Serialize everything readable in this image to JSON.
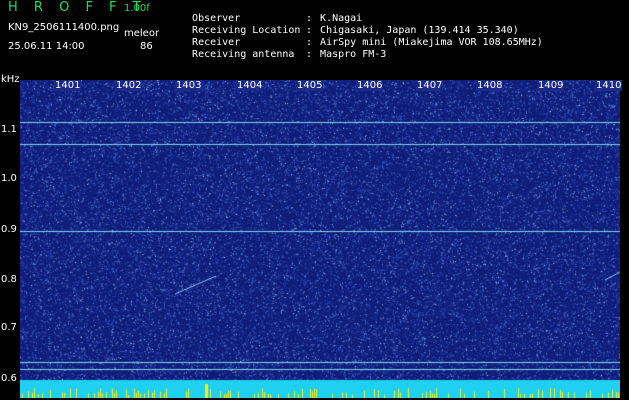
{
  "header": {
    "app_title": "H R O F F T",
    "version": "1.00f",
    "file": "KN9_2506111400.png",
    "mode": "meleor",
    "datetime": "25.06.11 14:00",
    "count": "86"
  },
  "station": [
    {
      "label": "Observer",
      "value": "K.Nagai"
    },
    {
      "label": "Receiving Location",
      "value": "Chigasaki, Japan (139.414 35.340)"
    },
    {
      "label": "Receiver",
      "value": "AirSpy mini (Miakejima VOR 108.65MHz)"
    },
    {
      "label": "Receiving antenna",
      "value": "Maspro FM-3"
    }
  ],
  "spectrogram": {
    "unit": "kHz",
    "y_ticks": [
      "1.1",
      "1.0",
      "0.9",
      "0.8",
      "0.7",
      "0.6"
    ],
    "x_ticks": [
      "1401",
      "1402",
      "1403",
      "1404",
      "1405",
      "1406",
      "1407",
      "1408",
      "1409",
      "1410"
    ],
    "ylim_khz": [
      0.58,
      1.18
    ],
    "carrier_lines_khz": [
      1.095,
      1.052,
      0.878,
      0.616,
      0.603
    ],
    "colors": {
      "background": "#101e7a",
      "noise": "#4a7ad8",
      "line": "#7cd6e8",
      "bottom_band": "#1fd0f0",
      "peaks": "#f7f01a"
    }
  }
}
